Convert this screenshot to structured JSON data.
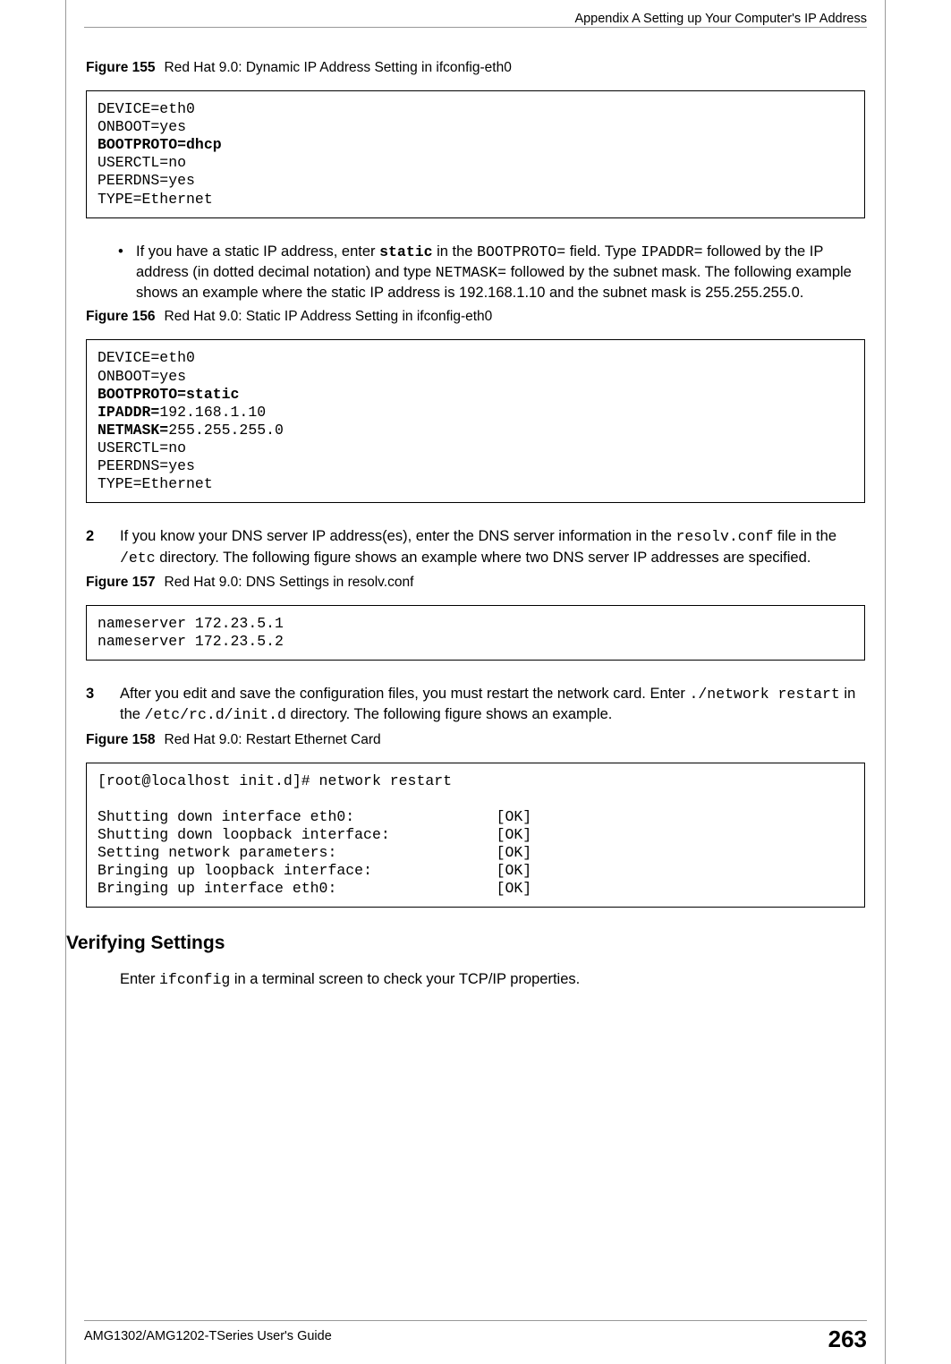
{
  "running_head": "Appendix A Setting up Your Computer's IP Address",
  "footer": {
    "guide": "AMG1302/AMG1202-TSeries User's Guide",
    "page": "263"
  },
  "fig155": {
    "label": "Figure 155",
    "caption": "Red Hat 9.0: Dynamic IP Address Setting in ifconfig-eth0",
    "lines": {
      "l0": "DEVICE=eth0",
      "l1": "ONBOOT=yes",
      "l2": "BOOTPROTO=dhcp",
      "l3": "USERCTL=no",
      "l4": "PEERDNS=yes",
      "l5": "TYPE=Ethernet"
    }
  },
  "bullet_static": {
    "pre": "If you have a static IP address, enter ",
    "static": "static",
    "mid1": " in the ",
    "bootproto": "BOOTPROTO=",
    "mid2": " field. Type ",
    "ipaddr": "IPADDR=",
    "mid3": " followed by the IP address (in dotted decimal notation) and type ",
    "netmask": "NETMASK=",
    "mid4": " followed by the subnet mask. The following example shows an example where the static IP address is 192.168.1.10 and the subnet mask is 255.255.255.0."
  },
  "fig156": {
    "label": "Figure 156",
    "caption": "Red Hat 9.0: Static IP Address Setting in ifconfig-eth0",
    "lines": {
      "l0": "DEVICE=eth0",
      "l1": "ONBOOT=yes",
      "l2": "BOOTPROTO=static",
      "l3a": "IPADDR=",
      "l3b": "192.168.1.10",
      "l4a": "NETMASK=",
      "l4b": "255.255.255.0",
      "l5": "USERCTL=no",
      "l6": "PEERDNS=yes",
      "l7": "TYPE=Ethernet"
    }
  },
  "step2": {
    "num": "2",
    "pre": "If you know your DNS server IP address(es), enter the DNS server information in the ",
    "resolv": "resolv.conf",
    "mid1": " file in the ",
    "etc": "/etc",
    "post": " directory. The following figure shows an example where two DNS server IP addresses are specified."
  },
  "fig157": {
    "label": "Figure 157",
    "caption": "Red Hat 9.0: DNS Settings in resolv.conf",
    "lines": {
      "l0": "nameserver 172.23.5.1",
      "l1": "nameserver 172.23.5.2"
    }
  },
  "step3": {
    "num": "3",
    "pre": "After you edit and save the configuration files, you must restart the network card. Enter ",
    "cmd": "./network restart",
    "mid": " in the ",
    "dir": "/etc/rc.d/init.d",
    "post": " directory.  The following figure shows an example."
  },
  "fig158": {
    "label": "Figure 158",
    "caption": "Red Hat 9.0: Restart Ethernet Card",
    "lines": {
      "l0": "[root@localhost init.d]# network restart",
      "blank": "",
      "l1": "Shutting down interface eth0:                [OK]",
      "l2": "Shutting down loopback interface:            [OK]",
      "l3": "Setting network parameters:                  [OK]",
      "l4": "Bringing up loopback interface:              [OK]",
      "l5": "Bringing up interface eth0:                  [OK]"
    }
  },
  "verify": {
    "heading": "Verifying Settings",
    "pre": "Enter ",
    "cmd": "ifconfig",
    "post": " in a terminal screen to check your TCP/IP properties."
  }
}
